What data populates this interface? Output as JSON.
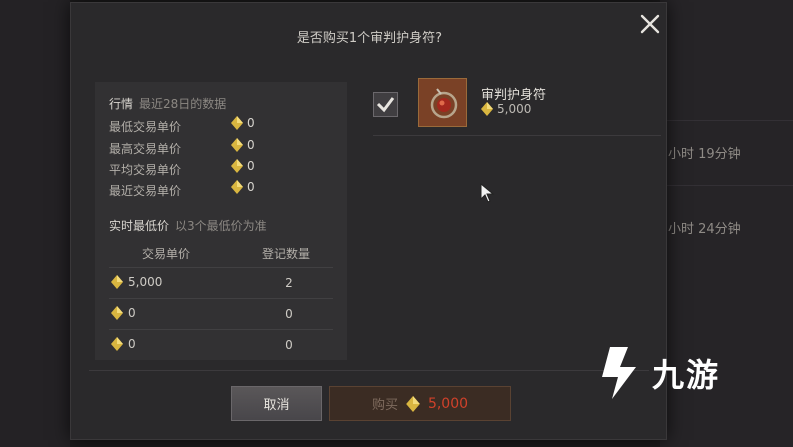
{
  "dialog": {
    "title": "是否购买1个审判护身符?"
  },
  "market": {
    "heading": "行情",
    "heading_sub": "最近28日的数据",
    "stats": [
      {
        "label": "最低交易单价",
        "value": "0"
      },
      {
        "label": "最高交易单价",
        "value": "0"
      },
      {
        "label": "平均交易单价",
        "value": "0"
      },
      {
        "label": "最近交易单价",
        "value": "0"
      }
    ],
    "realtime_heading": "实时最低价",
    "realtime_sub": "以3个最低价为准",
    "columns": [
      "交易单价",
      "登记数量"
    ],
    "rows": [
      {
        "price": "5,000",
        "qty": "2"
      },
      {
        "price": "0",
        "qty": "0"
      },
      {
        "price": "0",
        "qty": "0"
      }
    ]
  },
  "item": {
    "name": "审判护身符",
    "price": "5,000",
    "checked": true,
    "icon": "amulet-icon"
  },
  "buttons": {
    "cancel": "取消",
    "buy": "购买",
    "buy_amount": "5,000"
  },
  "background": {
    "texts": [
      "小时 19分钟",
      "小时 24分钟"
    ]
  },
  "watermark": {
    "text": "九游"
  },
  "colors": {
    "gem": "#d9b640",
    "price_red": "#d0412a",
    "panel": "#323133"
  }
}
